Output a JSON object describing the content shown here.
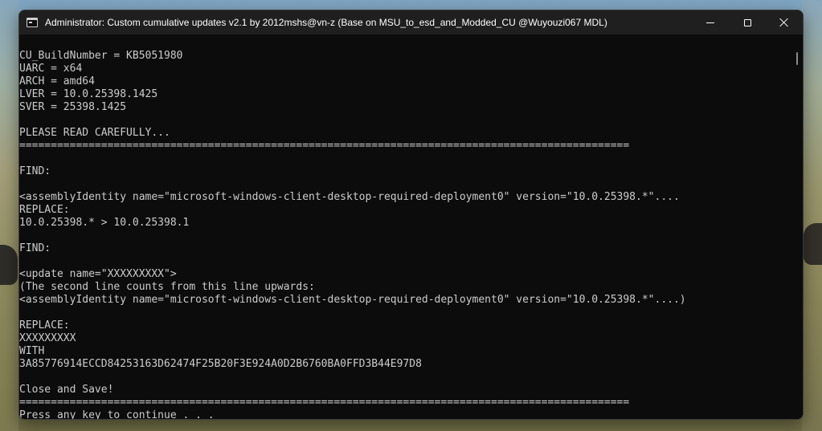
{
  "window": {
    "title": "Administrator:  Custom cumulative updates v2.1 by 2012mshs@vn-z (Base on MSU_to_esd_and_Modded_CU @Wuyouzi067 MDL)",
    "icon": "console-app-icon",
    "controls": {
      "minimize": "minimize-icon",
      "maximize": "maximize-icon",
      "close": "close-icon"
    }
  },
  "console": {
    "lines": [
      "CU_BuildNumber = KB5051980",
      "UARC = x64",
      "ARCH = amd64",
      "LVER = 10.0.25398.1425",
      "SVER = 25398.1425",
      "",
      "PLEASE READ CAREFULLY...",
      "=================================================================================================",
      "",
      "FIND:",
      "",
      "<assemblyIdentity name=\"microsoft-windows-client-desktop-required-deployment0\" version=\"10.0.25398.*\"....",
      "REPLACE:",
      "10.0.25398.* > 10.0.25398.1",
      "",
      "FIND:",
      "",
      "<update name=\"XXXXXXXXX\">",
      "(The second line counts from this line upwards:",
      "<assemblyIdentity name=\"microsoft-windows-client-desktop-required-deployment0\" version=\"10.0.25398.*\"....)",
      "",
      "REPLACE:",
      "XXXXXXXXX",
      "WITH",
      "3A85776914ECCD84253163D62474F25B20F3E924A0D2B6760BA0FFD3B44E97D8",
      "",
      "Close and Save!",
      "=================================================================================================",
      "Press any key to continue . . ."
    ],
    "colors": {
      "background": "#0c0c0c",
      "text": "#cccccc",
      "titlebar": "#1f1f1f"
    }
  }
}
